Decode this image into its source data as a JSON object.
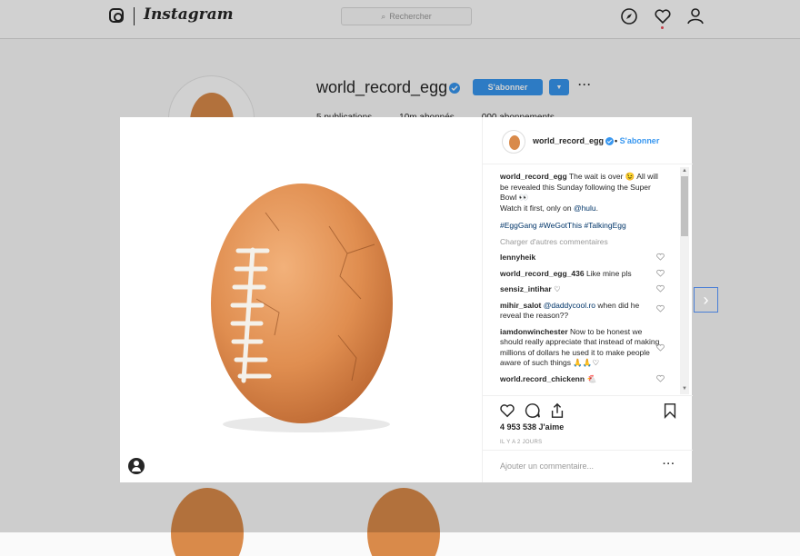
{
  "topbar": {
    "brand": "Instagram",
    "search_placeholder": "Rechercher",
    "icons": [
      "instagram-glyph-icon",
      "explore-compass-icon",
      "activity-heart-icon",
      "profile-person-icon"
    ]
  },
  "profile": {
    "username": "world_record_egg",
    "follow_label": "S'abonner",
    "more": "···",
    "stats": [
      "5 publications",
      "10m abonnés",
      "000 abonnements"
    ]
  },
  "post": {
    "username": "world_record_egg",
    "separator": "•",
    "follow_label": "S'abonner",
    "caption_user": "world_record_egg",
    "caption_text": "The wait is over 😉 All will be revealed this Sunday following the Super Bowl 👀",
    "caption_line2_prefix": "Watch it first, only on",
    "caption_mention": "@hulu",
    "caption_line2_suffix": ".",
    "hashtags": "#EggGang #WeGotThis #TalkingEgg",
    "load_more": "Charger d'autres commentaires",
    "comments": [
      {
        "user": "lennyheik",
        "text": ""
      },
      {
        "user": "world_record_egg_436",
        "text": "Like mine pls"
      },
      {
        "user": "sensiz_intihar",
        "text": "♡"
      },
      {
        "user": "mihir_salot",
        "mention": "@daddycool.ro",
        "text": "when did he reveal the reason??"
      },
      {
        "user": "iamdonwinchester",
        "text": "Now to be honest we should really appreciate that instead of making millions of dollars he used it to make people aware of such things 🙏🙏♡"
      },
      {
        "user": "world.record_chickenn",
        "text": "🐔"
      }
    ],
    "likes": "4 953 538 J'aime",
    "time_ago": "IL Y A 2 JOURS",
    "add_comment_placeholder": "Ajouter un commentaire...",
    "options": "···"
  },
  "next_arrow": "›",
  "colors": {
    "accent": "#3897f0",
    "egg": "#d98a4a",
    "link": "#003569"
  }
}
